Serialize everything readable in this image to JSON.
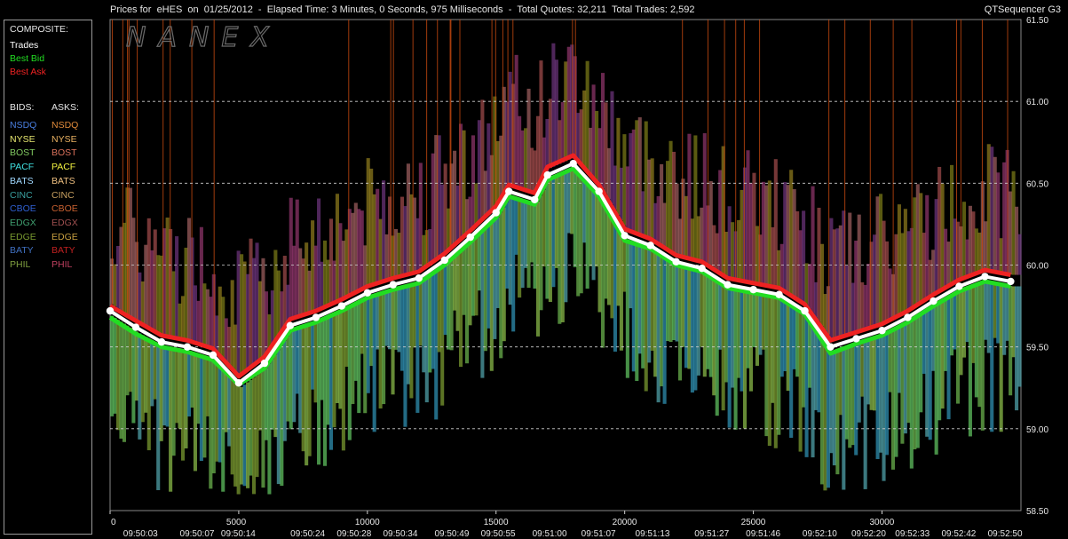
{
  "title_bar": {
    "text": "Prices for  eHES  on  01/25/2012  -  Elapsed Time: 3 Minutes, 0 Seconds, 975 Milliseconds  -  Total Quotes: 32,211  Total Trades: 2,592",
    "app_name": "QTSequencer G3"
  },
  "watermark": "NANEX",
  "legend": {
    "composite_heading": "COMPOSITE:",
    "composite": [
      {
        "label": "Trades",
        "color": "#ffffff"
      },
      {
        "label": "Best Bid",
        "color": "#22dd22"
      },
      {
        "label": "Best Ask",
        "color": "#ee2222"
      }
    ],
    "bids_heading": "BIDS:",
    "asks_heading": "ASKS:",
    "exchanges": [
      {
        "bid": "NSDQ",
        "ask": "NSDQ",
        "bid_color": "#4a7fe0",
        "ask_color": "#e08a3a"
      },
      {
        "bid": "NYSE",
        "ask": "NYSE",
        "bid_color": "#e8e870",
        "ask_color": "#e8b060"
      },
      {
        "bid": "BOST",
        "ask": "BOST",
        "bid_color": "#80c860",
        "ask_color": "#d8705a"
      },
      {
        "bid": "PACF",
        "ask": "PACF",
        "bid_color": "#40e0e0",
        "ask_color": "#f0f040"
      },
      {
        "bid": "BATS",
        "ask": "BATS",
        "bid_color": "#a0d8ff",
        "ask_color": "#f0c080"
      },
      {
        "bid": "CINC",
        "ask": "CINC",
        "bid_color": "#3aa0a0",
        "ask_color": "#c8a060"
      },
      {
        "bid": "CBOE",
        "ask": "CBOE",
        "bid_color": "#2f5fd0",
        "ask_color": "#c86030"
      },
      {
        "bid": "EDGX",
        "ask": "EDGX",
        "bid_color": "#40a070",
        "ask_color": "#a05050"
      },
      {
        "bid": "EDGE",
        "ask": "EDGE",
        "bid_color": "#7a9a30",
        "ask_color": "#c8a040"
      },
      {
        "bid": "BATY",
        "ask": "BATY",
        "bid_color": "#4070c0",
        "ask_color": "#c02020"
      },
      {
        "bid": "PHIL",
        "ask": "PHIL",
        "bid_color": "#80a040",
        "ask_color": "#c04060"
      }
    ]
  },
  "chart_data": {
    "type": "line",
    "title": "Prices for  eHES  on  01/25/2012",
    "xlabel": "",
    "ylabel": "",
    "x_ticks": [
      "0",
      "5000",
      "10000",
      "15000",
      "20000",
      "25000",
      "30000"
    ],
    "x_tick_values": [
      0,
      5000,
      10000,
      15000,
      20000,
      25000,
      30000
    ],
    "time_ticks": [
      "09:50:03",
      "09:50:07",
      "09:50:14",
      "09:50:24",
      "09:50:28",
      "09:50:34",
      "09:50:49",
      "09:50:55",
      "09:51:00",
      "09:51:07",
      "09:51:13",
      "09:51:27",
      "09:51:46",
      "09:52:10",
      "09:52:20",
      "09:52:33",
      "09:52:42",
      "09:52:50"
    ],
    "time_tick_values": [
      1200,
      3400,
      5000,
      7700,
      9500,
      11300,
      13300,
      15100,
      17100,
      19000,
      21100,
      23400,
      25400,
      27600,
      29500,
      31200,
      33000,
      34800
    ],
    "y_ticks": [
      "58.50",
      "59.00",
      "59.50",
      "60.00",
      "60.50",
      "61.00",
      "61.50"
    ],
    "y_tick_values": [
      58.5,
      59.0,
      59.5,
      60.0,
      60.5,
      61.0,
      61.5
    ],
    "xlim": [
      0,
      35400
    ],
    "ylim": [
      58.5,
      61.5
    ],
    "grid": true,
    "legend_position": "left panel",
    "series": [
      {
        "name": "Trades",
        "color": "#ffffff",
        "x": [
          0,
          1000,
          2000,
          3000,
          4000,
          5000,
          6000,
          7000,
          8000,
          9000,
          10000,
          11000,
          12000,
          13000,
          14000,
          15000,
          15500,
          16500,
          17000,
          18000,
          19000,
          20000,
          21000,
          22000,
          23000,
          24000,
          25000,
          26000,
          27000,
          28000,
          29000,
          30000,
          31000,
          32000,
          33000,
          34000,
          35000
        ],
        "y": [
          59.72,
          59.62,
          59.53,
          59.5,
          59.45,
          59.28,
          59.4,
          59.63,
          59.68,
          59.75,
          59.83,
          59.88,
          59.92,
          60.03,
          60.17,
          60.32,
          60.45,
          60.4,
          60.55,
          60.62,
          60.45,
          60.18,
          60.12,
          60.02,
          59.98,
          59.88,
          59.85,
          59.82,
          59.72,
          59.5,
          59.55,
          59.6,
          59.68,
          59.78,
          59.87,
          59.93,
          59.9
        ]
      },
      {
        "name": "Best Bid",
        "color": "#22dd22",
        "x": [
          0,
          1000,
          2000,
          3000,
          4000,
          5000,
          6000,
          7000,
          8000,
          9000,
          10000,
          11000,
          12000,
          13000,
          14000,
          15000,
          15500,
          16500,
          17000,
          18000,
          19000,
          20000,
          21000,
          22000,
          23000,
          24000,
          25000,
          26000,
          27000,
          28000,
          29000,
          30000,
          31000,
          32000,
          33000,
          34000,
          35000
        ],
        "y": [
          59.68,
          59.58,
          59.5,
          59.47,
          59.42,
          59.27,
          59.37,
          59.6,
          59.65,
          59.72,
          59.8,
          59.85,
          59.89,
          60.0,
          60.14,
          60.29,
          60.42,
          60.37,
          60.52,
          60.59,
          60.42,
          60.15,
          60.1,
          60.0,
          59.96,
          59.86,
          59.83,
          59.8,
          59.7,
          59.46,
          59.52,
          59.57,
          59.65,
          59.75,
          59.84,
          59.9,
          59.87
        ]
      },
      {
        "name": "Best Ask",
        "color": "#ee2222",
        "x": [
          0,
          1000,
          2000,
          3000,
          4000,
          5000,
          6000,
          7000,
          8000,
          9000,
          10000,
          11000,
          12000,
          13000,
          14000,
          15000,
          15500,
          16500,
          17000,
          18000,
          19000,
          20000,
          21000,
          22000,
          23000,
          24000,
          25000,
          26000,
          27000,
          28000,
          29000,
          30000,
          31000,
          32000,
          33000,
          34000,
          35000
        ],
        "y": [
          59.75,
          59.66,
          59.57,
          59.54,
          59.49,
          59.32,
          59.44,
          59.67,
          59.72,
          59.79,
          59.87,
          59.92,
          59.96,
          60.07,
          60.21,
          60.36,
          60.49,
          60.44,
          60.6,
          60.67,
          60.49,
          60.22,
          60.16,
          60.06,
          60.02,
          59.92,
          59.89,
          59.86,
          59.76,
          59.54,
          59.59,
          59.64,
          59.72,
          59.82,
          59.91,
          59.97,
          59.94
        ]
      }
    ]
  }
}
